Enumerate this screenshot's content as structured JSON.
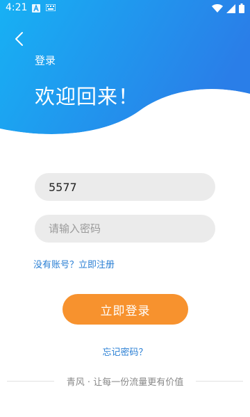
{
  "status_bar": {
    "time": "4:21",
    "icons": [
      "a-letter-icon",
      "keyboard-icon",
      "wifi-icon",
      "signal-icon",
      "battery-icon"
    ]
  },
  "header": {
    "back_icon": "chevron-left-icon",
    "title": "登录",
    "welcome": "欢迎回来！"
  },
  "form": {
    "account_value": "5577",
    "password_placeholder": "请输入密码",
    "register_link": "没有账号？立即注册",
    "login_button": "立即登录",
    "forgot_link": "忘记密码？"
  },
  "footer": {
    "slogan": "青风 · 让每一份流量更有价值"
  },
  "colors": {
    "gradient_start": "#17b1f4",
    "gradient_end": "#2a7ee8",
    "accent_orange": "#f7922e",
    "link_blue": "#2a7fd4",
    "input_bg": "#ebebeb"
  }
}
